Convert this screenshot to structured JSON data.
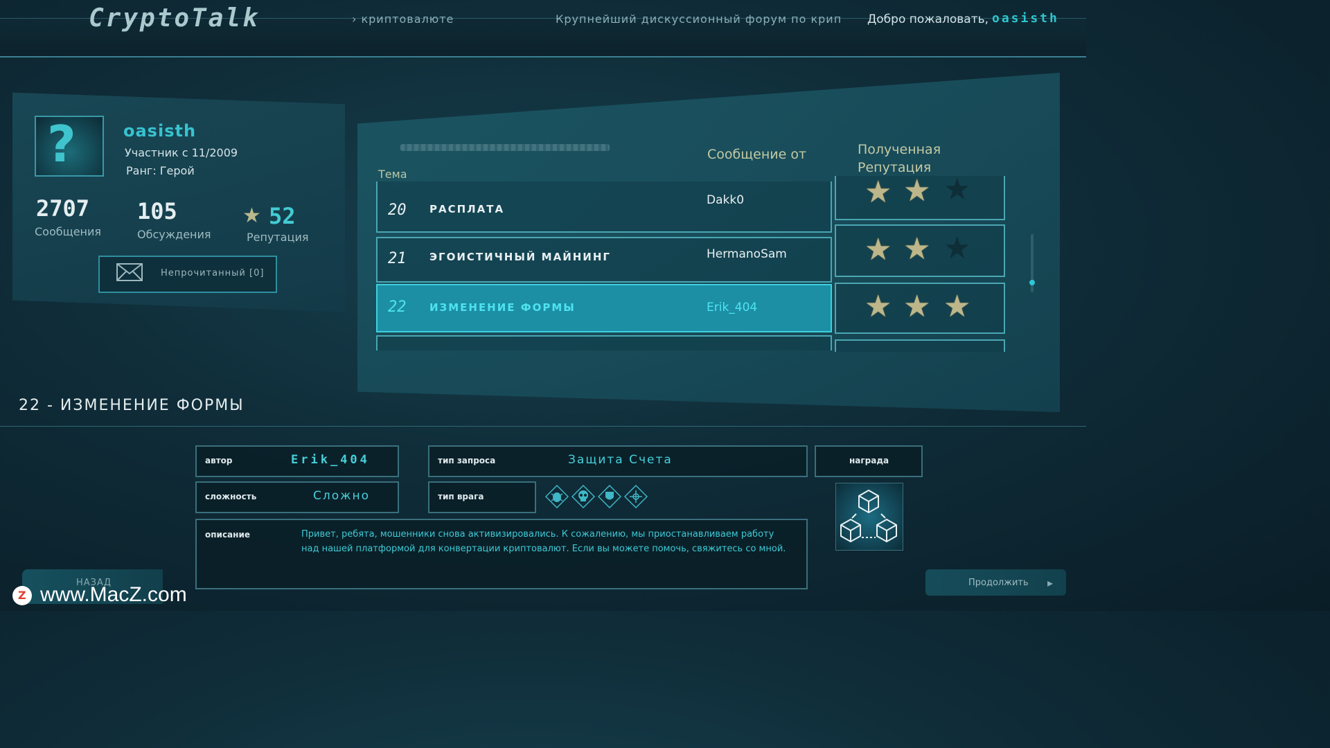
{
  "header": {
    "logo": "CryptoTalk",
    "ticker_left": "› криптовалюте",
    "ticker_right": "Крупнейший дискуссионный форум по крип",
    "welcome": "Добро пожаловать,",
    "username": "oasisth"
  },
  "profile": {
    "username": "oasisth",
    "member_since": "Участник с 11/2009",
    "rank": "Ранг: Герой",
    "messages_count": "2707",
    "messages_label": "Сообщения",
    "discussions_count": "105",
    "discussions_label": "Обсуждения",
    "reputation_count": "52",
    "reputation_label": "Репутация",
    "unread_label": "Непрочитанный [0]"
  },
  "topics": {
    "header_topic": "Тема",
    "header_from": "Сообщение от",
    "header_reputation": "Полученная Репутация",
    "rows": [
      {
        "num": "20",
        "title": "РАСПЛАТА",
        "author": "Dakk0",
        "stars": 2
      },
      {
        "num": "21",
        "title": "ЭГОИСТИЧНЫЙ МАЙНИНГ",
        "author": "HermanoSam",
        "stars": 2
      },
      {
        "num": "22",
        "title": "ИЗМЕНЕНИЕ ФОРМЫ",
        "author": "Erik_404",
        "stars": 3
      }
    ],
    "selected_index": 2
  },
  "detail": {
    "title": "22 - ИЗМЕНЕНИЕ ФОРМЫ",
    "author_label": "автор",
    "author_value": "Erik_404",
    "request_type_label": "тип запроса",
    "request_type_value": "Защита Счета",
    "reward_label": "награда",
    "difficulty_label": "сложность",
    "difficulty_value": "Сложно",
    "enemy_type_label": "тип врага",
    "enemy_icons": [
      "bug-icon",
      "skull-icon",
      "shield-icon",
      "crosshair-icon"
    ],
    "description_label": "описание",
    "description": "Привет, ребята, мошенники снова активизировались. К сожалению, мы приостанавливаем работу над нашей платформой для конвертации криптовалют. Если вы можете помочь, свяжитесь со мной."
  },
  "footer": {
    "back_label": "НАЗАД",
    "continue_label": "Продолжить"
  },
  "watermark": {
    "text": "www.MacZ.com",
    "logo_letter": "Z"
  },
  "colors": {
    "accent": "#2ec7d0",
    "selected_row": "#1c8fa5",
    "star_on": "#bcb68a"
  }
}
